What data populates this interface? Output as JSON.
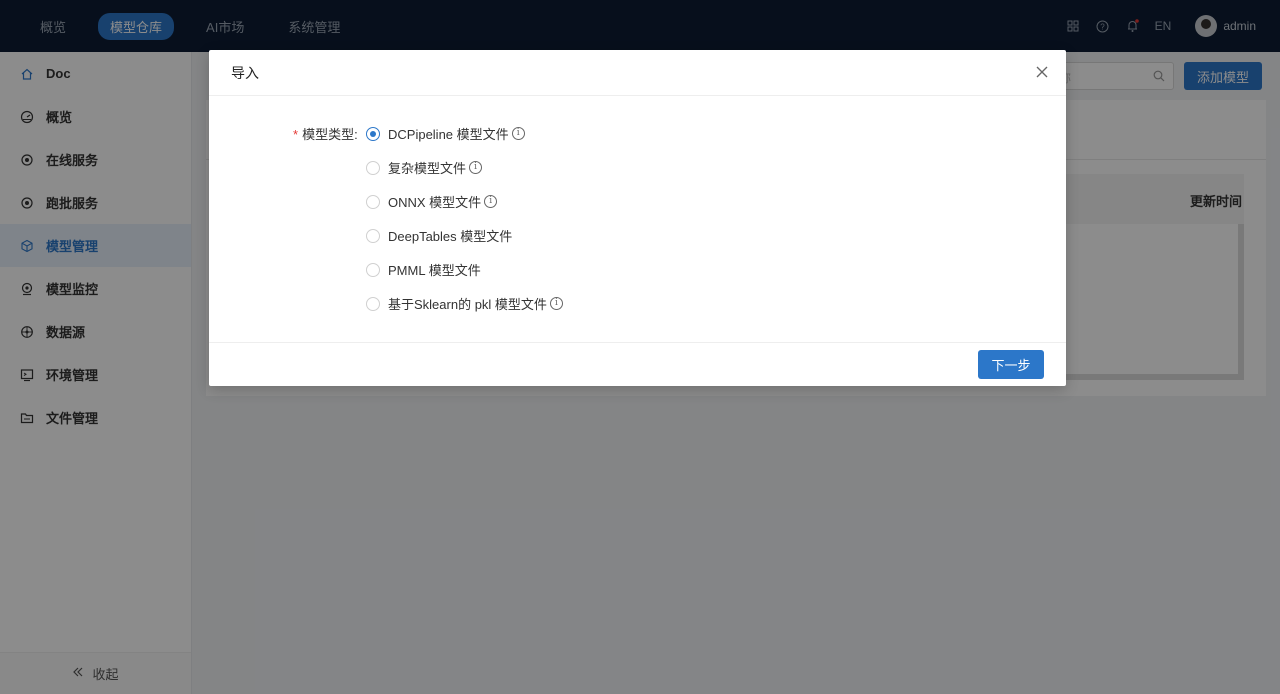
{
  "topnav": {
    "items": [
      {
        "label": "概览",
        "active": false
      },
      {
        "label": "模型仓库",
        "active": true
      },
      {
        "label": "AI市场",
        "active": false
      },
      {
        "label": "系统管理",
        "active": false
      }
    ]
  },
  "header_right": {
    "lang": "EN",
    "username": "admin",
    "icons": [
      "apps-icon",
      "help-icon",
      "bell-icon"
    ]
  },
  "sidebar": {
    "items": [
      {
        "label": "Doc",
        "icon": "home-icon",
        "active": false
      },
      {
        "label": "概览",
        "icon": "dashboard-icon",
        "active": false
      },
      {
        "label": "在线服务",
        "icon": "target-icon",
        "active": false
      },
      {
        "label": "跑批服务",
        "icon": "target-icon",
        "active": false
      },
      {
        "label": "模型管理",
        "icon": "cube-icon",
        "active": true
      },
      {
        "label": "模型监控",
        "icon": "monitor-icon",
        "active": false
      },
      {
        "label": "数据源",
        "icon": "data-source-icon",
        "active": false
      },
      {
        "label": "环境管理",
        "icon": "environment-icon",
        "active": false
      },
      {
        "label": "文件管理",
        "icon": "folder-icon",
        "active": false
      }
    ],
    "collapse_label": "收起"
  },
  "background": {
    "search_placeholder": "称",
    "add_button": "添加模型",
    "table_column": "更新时间"
  },
  "modal": {
    "title": "导入",
    "field_label": "模型类型:",
    "options": [
      {
        "label": "DCPipeline 模型文件",
        "checked": true,
        "info": true
      },
      {
        "label": "复杂模型文件",
        "checked": false,
        "info": true
      },
      {
        "label": "ONNX 模型文件",
        "checked": false,
        "info": true
      },
      {
        "label": "DeepTables 模型文件",
        "checked": false,
        "info": false
      },
      {
        "label": "PMML 模型文件",
        "checked": false,
        "info": false
      },
      {
        "label": "基于Sklearn的 pkl 模型文件",
        "checked": false,
        "info": true
      }
    ],
    "next_button": "下一步"
  },
  "colors": {
    "accent": "#2c77c9",
    "topbar": "#0d1d33",
    "required": "#e53935"
  }
}
